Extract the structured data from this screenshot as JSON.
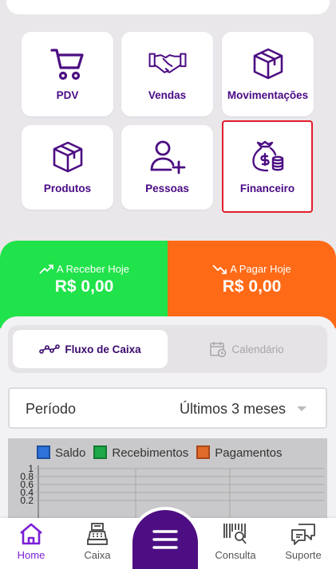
{
  "tiles": [
    {
      "label": "PDV",
      "icon": "shopping-cart-icon"
    },
    {
      "label": "Vendas",
      "icon": "handshake-icon"
    },
    {
      "label": "Movimentações",
      "icon": "box-icon"
    },
    {
      "label": "Produtos",
      "icon": "box-icon"
    },
    {
      "label": "Pessoas",
      "icon": "add-person-icon"
    },
    {
      "label": "Financeiro",
      "icon": "money-bag-icon",
      "selected": true
    }
  ],
  "summary": {
    "receive": {
      "title": "A Receber Hoje",
      "value": "R$ 0,00",
      "color": "#20e24a"
    },
    "pay": {
      "title": "A Pagar Hoje",
      "value": "R$ 0,00",
      "color": "#ff6a17"
    }
  },
  "tabs": {
    "active": "Fluxo de Caixa",
    "inactive": "Calendário"
  },
  "period": {
    "label": "Período",
    "value": "Últimos 3 meses"
  },
  "chart_data": {
    "type": "bar",
    "series": [
      {
        "name": "Saldo",
        "color": "#2f73d9",
        "values": []
      },
      {
        "name": "Recebimentos",
        "color": "#1fa84a",
        "values": []
      },
      {
        "name": "Pagamentos",
        "color": "#e06a2a",
        "values": []
      }
    ],
    "y_ticks": [
      "1",
      "0.8",
      "0.6",
      "0.4",
      "0.2"
    ],
    "ylim": [
      0,
      1
    ],
    "grid": true,
    "legend_position": "top"
  },
  "nav": {
    "home": "Home",
    "caixa": "Caixa",
    "consulta": "Consulta",
    "suporte": "Suporte"
  },
  "colors": {
    "brand": "#4c0e82",
    "accent": "#7b1fd6",
    "selection": "#e21d2c"
  }
}
